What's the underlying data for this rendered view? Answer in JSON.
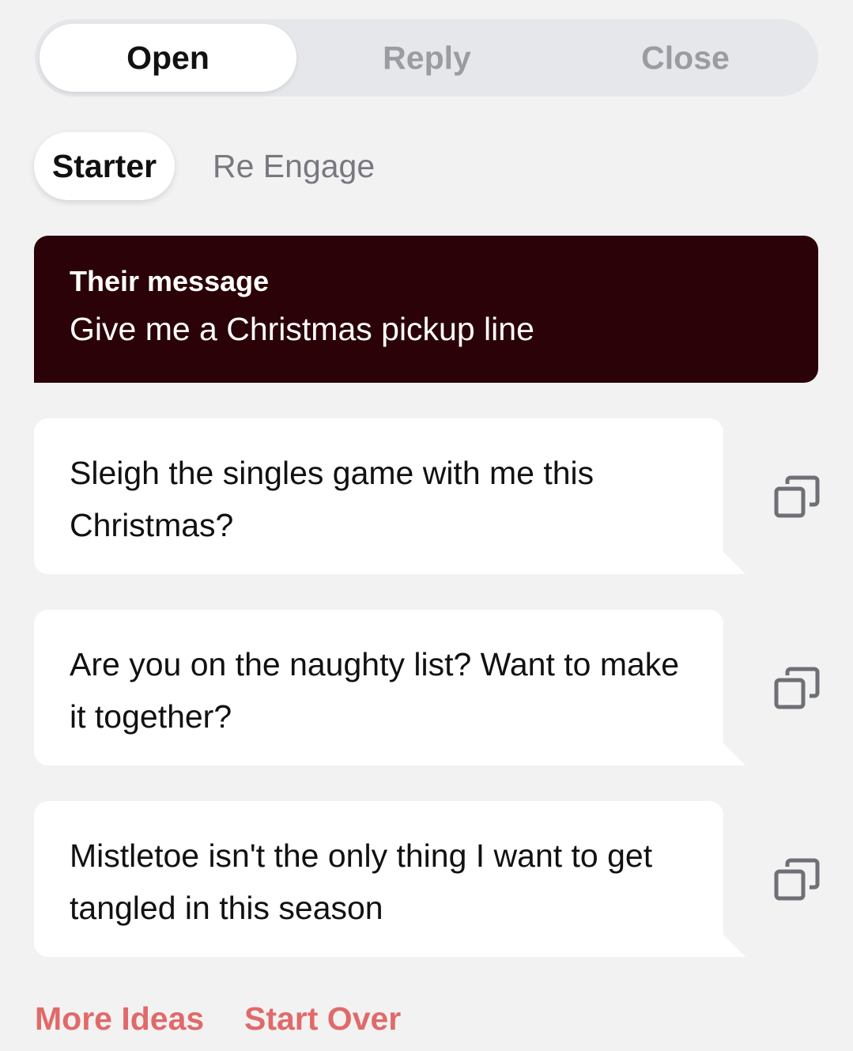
{
  "mode_tabs": [
    {
      "label": "Open",
      "active": true
    },
    {
      "label": "Reply",
      "active": false
    },
    {
      "label": "Close",
      "active": false
    }
  ],
  "sub_tabs": [
    {
      "label": "Starter",
      "active": true
    },
    {
      "label": "Re Engage",
      "active": false
    }
  ],
  "their_message": {
    "label": "Their message",
    "text": "Give me a Christmas pickup line"
  },
  "suggestions": [
    {
      "text": "Sleigh the singles game with me this Christmas?",
      "icon": "copy-icon"
    },
    {
      "text": "Are you on the naughty list? Want to make it together?",
      "icon": "copy-icon"
    },
    {
      "text": "Mistletoe isn't the only thing I want to get tangled in this season",
      "icon": "copy-icon"
    }
  ],
  "actions": {
    "more_ideas": "More Ideas",
    "start_over": "Start Over"
  },
  "colors": {
    "background": "#f2f2f2",
    "their_message_bg": "#2b0207",
    "accent": "#e06a6a",
    "inactive_text": "#9b9ca2"
  }
}
